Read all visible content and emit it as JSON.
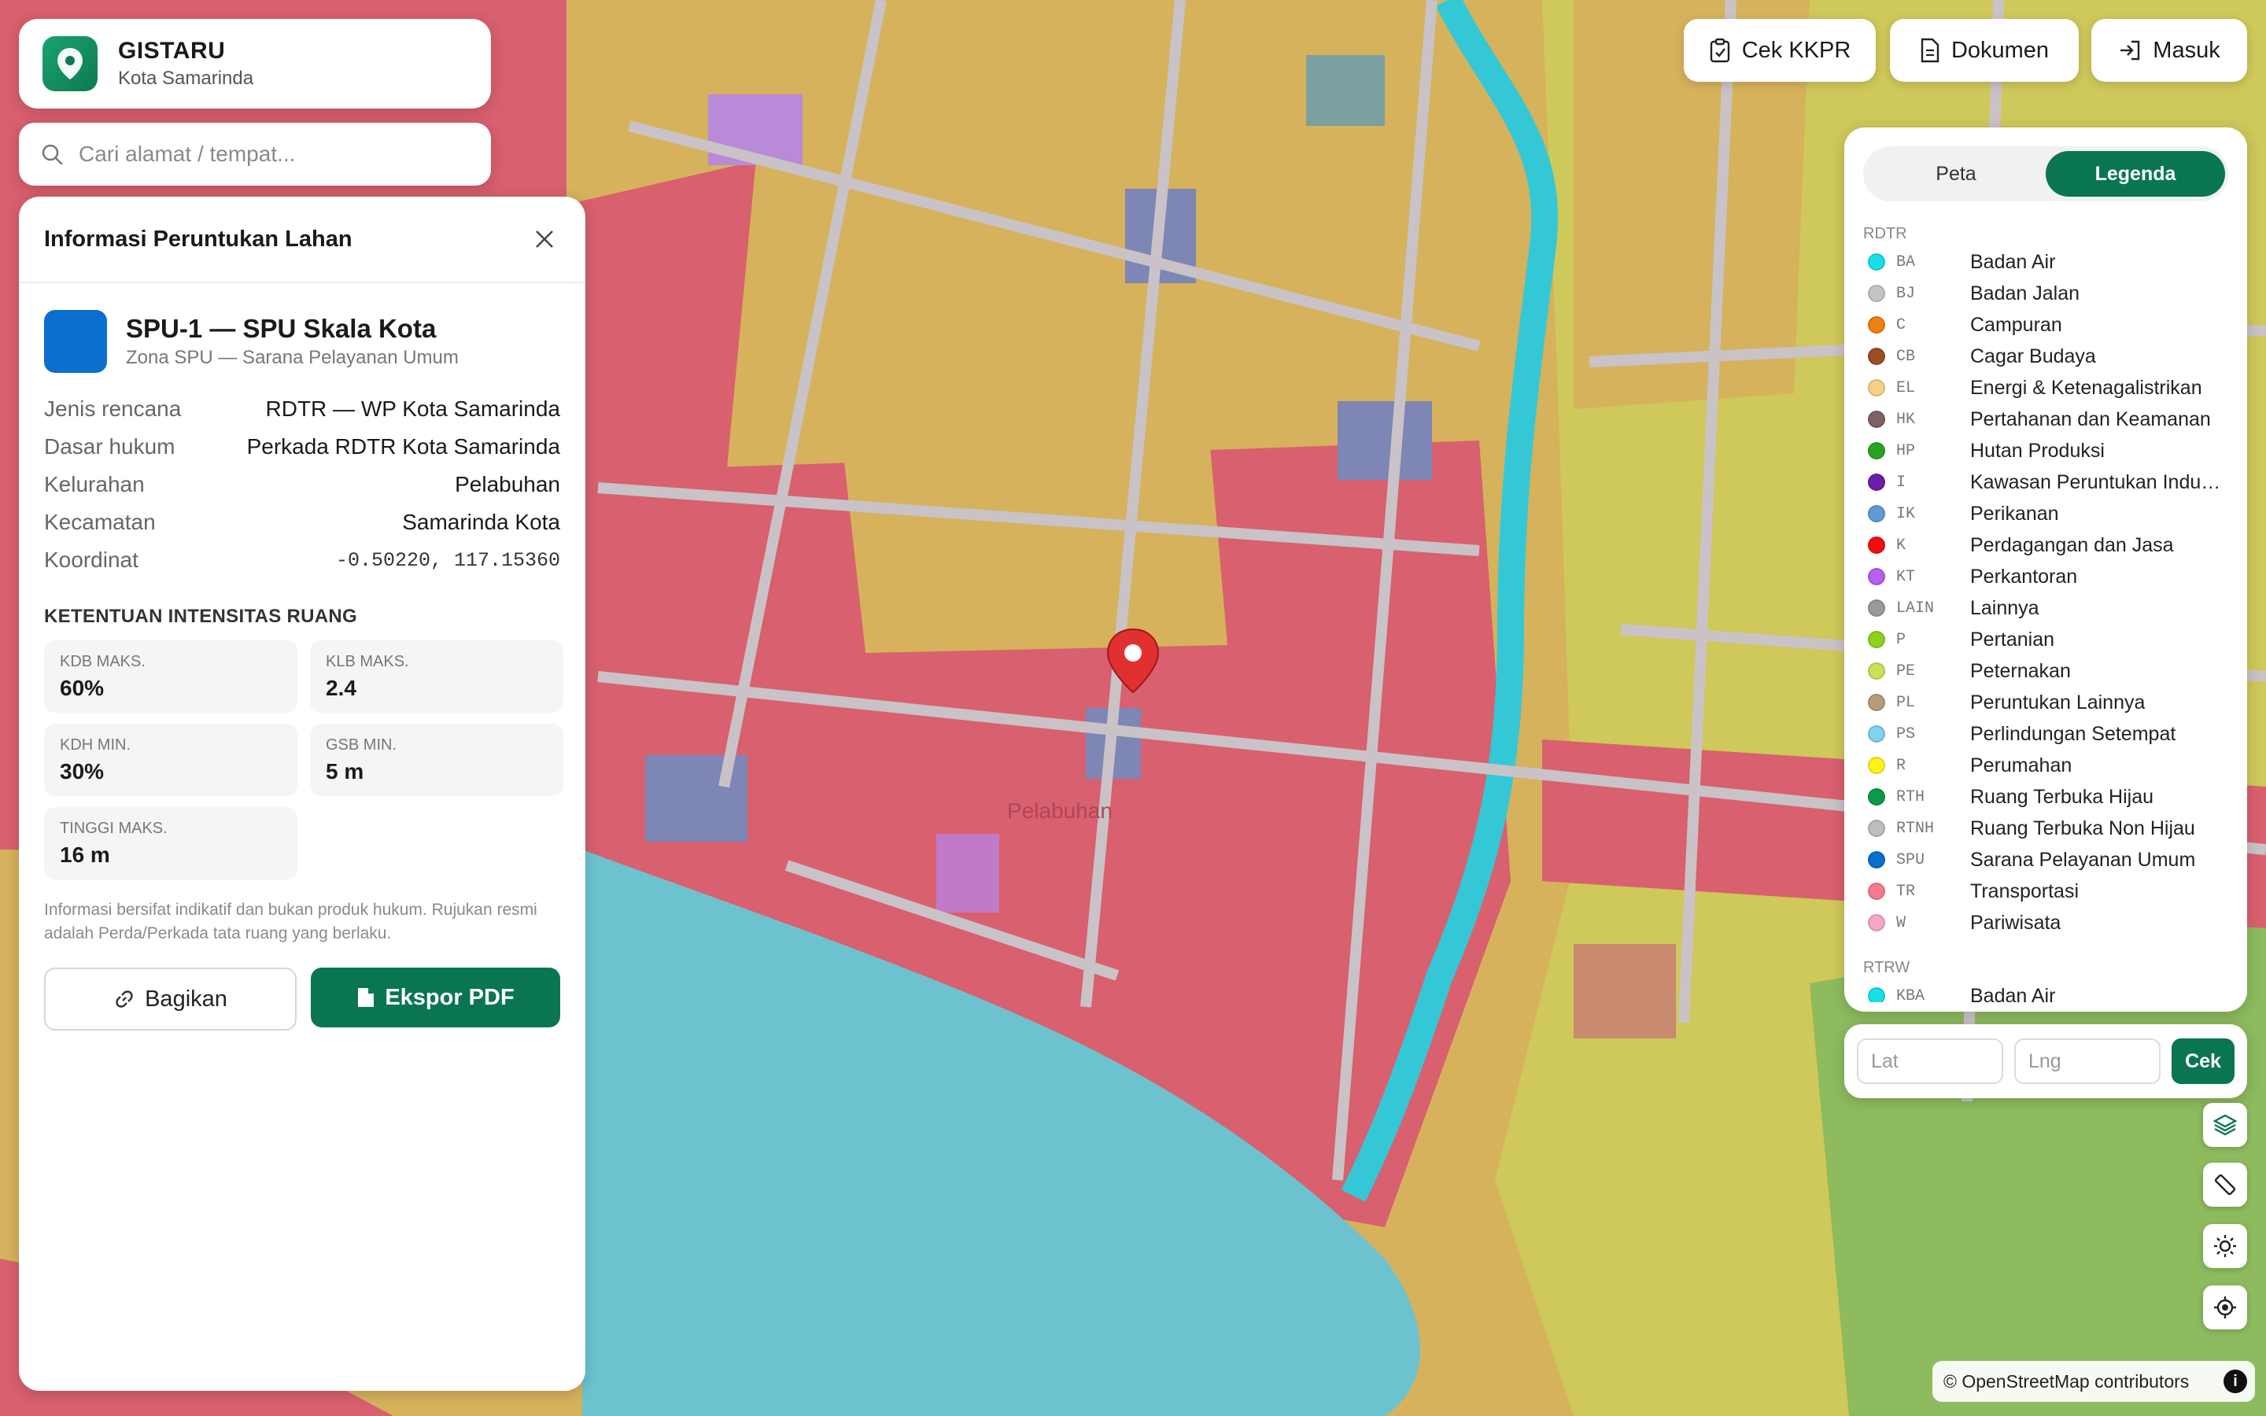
{
  "brand": {
    "title": "GISTARU",
    "subtitle": "Kota Samarinda"
  },
  "search": {
    "placeholder": "Cari alamat / tempat..."
  },
  "header_buttons": {
    "kkpr": "Cek KKPR",
    "dokumen": "Dokumen",
    "masuk": "Masuk"
  },
  "info": {
    "title": "Informasi Peruntukan Lahan",
    "zone_name": "SPU-1 — SPU Skala Kota",
    "zone_desc": "Zona SPU — Sarana Pelayanan Umum",
    "zone_color": "#0b6fcf",
    "rows": [
      {
        "key": "Jenis rencana",
        "value": "RDTR — WP Kota Samarinda"
      },
      {
        "key": "Dasar hukum",
        "value": "Perkada RDTR Kota Samarinda"
      },
      {
        "key": "Kelurahan",
        "value": "Pelabuhan"
      },
      {
        "key": "Kecamatan",
        "value": "Samarinda Kota"
      },
      {
        "key": "Koordinat",
        "value": "-0.50220, 117.15360"
      }
    ],
    "section_title": "KETENTUAN INTENSITAS RUANG",
    "cells": [
      {
        "label": "KDB MAKS.",
        "value": "60%"
      },
      {
        "label": "KLB MAKS.",
        "value": "2.4"
      },
      {
        "label": "KDH MIN.",
        "value": "30%"
      },
      {
        "label": "GSB MIN.",
        "value": "5 m"
      },
      {
        "label": "TINGGI MAKS.",
        "value": "16 m"
      }
    ],
    "note": "Informasi bersifat indikatif dan bukan produk hukum. Rujukan resmi adalah Perda/Perkada tata ruang yang berlaku.",
    "share_label": "Bagikan",
    "export_label": "Ekspor PDF"
  },
  "legend": {
    "tab_map": "Peta",
    "tab_legend": "Legenda",
    "group_rdtr": "RDTR",
    "items": [
      {
        "code": "BA",
        "name": "Badan Air",
        "color": "#19e0e8"
      },
      {
        "code": "BJ",
        "name": "Badan Jalan",
        "color": "#c4c4c4"
      },
      {
        "code": "C",
        "name": "Campuran",
        "color": "#f07f14"
      },
      {
        "code": "CB",
        "name": "Cagar Budaya",
        "color": "#9b4f25"
      },
      {
        "code": "EL",
        "name": "Energi & Ketenagalistrikan",
        "color": "#f7cf86"
      },
      {
        "code": "HK",
        "name": "Pertahanan dan Keamanan",
        "color": "#7d6364"
      },
      {
        "code": "HP",
        "name": "Hutan Produksi",
        "color": "#2aa325"
      },
      {
        "code": "I",
        "name": "Kawasan Peruntukan Industri",
        "color": "#6a1fa8"
      },
      {
        "code": "IK",
        "name": "Perikanan",
        "color": "#5f9cd6"
      },
      {
        "code": "K",
        "name": "Perdagangan dan Jasa",
        "color": "#ee1010"
      },
      {
        "code": "KT",
        "name": "Perkantoran",
        "color": "#b65ff0"
      },
      {
        "code": "LAIN",
        "name": "Lainnya",
        "color": "#9a9a9a"
      },
      {
        "code": "P",
        "name": "Pertanian",
        "color": "#8fd11c"
      },
      {
        "code": "PE",
        "name": "Peternakan",
        "color": "#cbe05a"
      },
      {
        "code": "PL",
        "name": "Peruntukan Lainnya",
        "color": "#b89a7c"
      },
      {
        "code": "PS",
        "name": "Perlindungan Setempat",
        "color": "#7fd3ee"
      },
      {
        "code": "R",
        "name": "Perumahan",
        "color": "#fff21a"
      },
      {
        "code": "RTH",
        "name": "Ruang Terbuka Hijau",
        "color": "#0a9b4a"
      },
      {
        "code": "RTNH",
        "name": "Ruang Terbuka Non Hijau",
        "color": "#bdbdbd"
      },
      {
        "code": "SPU",
        "name": "Sarana Pelayanan Umum",
        "color": "#0b6fcf"
      },
      {
        "code": "TR",
        "name": "Transportasi",
        "color": "#f57c8f"
      },
      {
        "code": "W",
        "name": "Pariwisata",
        "color": "#f7a6c8"
      }
    ],
    "group_rtrw": "RTRW",
    "rtrw_items": [
      {
        "code": "KBA",
        "name": "Badan Air",
        "color": "#19e0e8"
      }
    ]
  },
  "coord": {
    "lat_placeholder": "Lat",
    "lng_placeholder": "Lng",
    "check_label": "Cek"
  },
  "attribution": "© OpenStreetMap contributors",
  "map_labels": {
    "area": "Pelabuhan"
  },
  "map_colors": {
    "commerce": "#d9606e",
    "housing": "#d6b25c",
    "water": "#6cc3cf",
    "river": "#34c8d6",
    "yellow": "#cfc85a",
    "green": "#8dbb5e",
    "public": "#7d86b4",
    "office": "#b88ad8",
    "road": "#c9c3c8",
    "heritage": "#c98a70"
  }
}
